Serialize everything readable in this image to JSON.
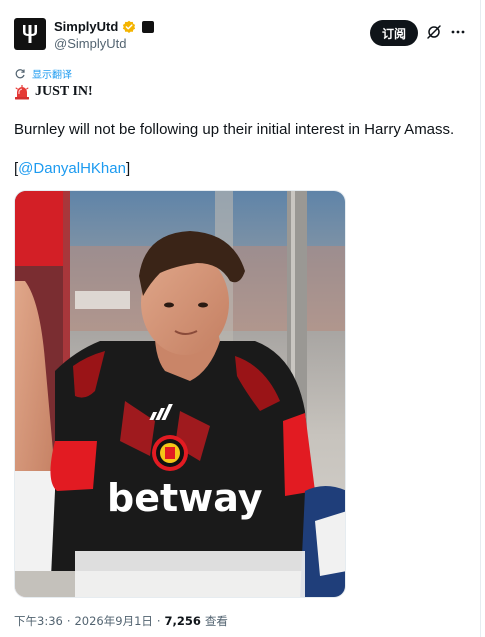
{
  "account": {
    "display_name": "SimplyUtd",
    "handle": "@SimplyUtd",
    "avatar_icon": "trident-icon",
    "verified_color": "#f4b400"
  },
  "actions": {
    "subscribe_label": "订阅"
  },
  "tweet": {
    "translate_label": "显示翻译",
    "headline": "JUST IN!",
    "body": "Burnley will not be following up their initial interest in Harry Amass.",
    "mention_open": "[",
    "mention": "@DanyalHKhan",
    "mention_close": "]",
    "media": {
      "jersey_text": "betway"
    }
  },
  "meta": {
    "time": "下午3:36",
    "date": "2026年9月1日",
    "views": "7,256",
    "views_label": "查看",
    "separator": "·"
  },
  "colors": {
    "accent": "#1d9bf0",
    "text": "#0f1419",
    "muted": "#536471"
  }
}
